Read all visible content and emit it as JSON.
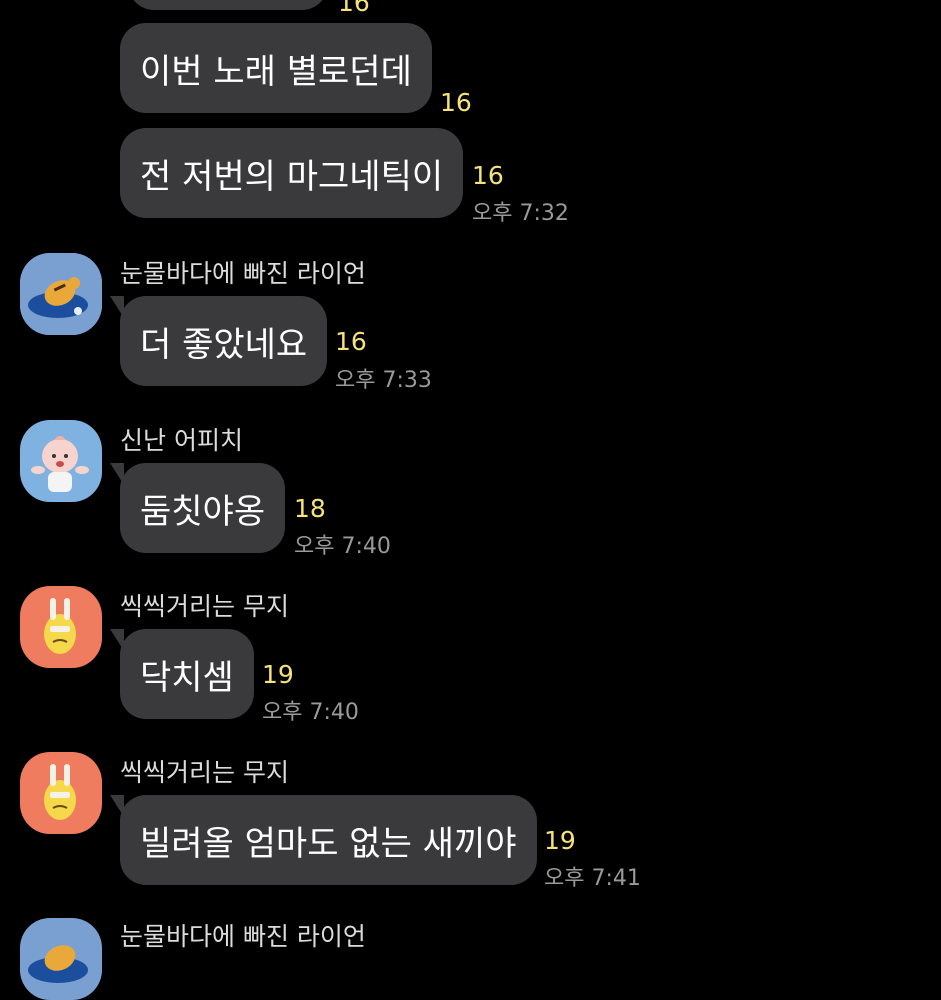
{
  "chat": {
    "colors": {
      "background": "#000000",
      "bubble": "#3a3a3c",
      "unread": "#f5e27a",
      "time": "#9a9a9a"
    },
    "messages": [
      {
        "text": "",
        "unread": "16"
      },
      {
        "text": "이번 노래 별로던데",
        "unread": "16"
      },
      {
        "text": "전 저번의 마그네틱이",
        "unread": "16",
        "time": "오후 7:32"
      },
      {
        "sender": "눈물바다에 빠진 라이언",
        "avatar": "ryan-avatar",
        "text": "더 좋았네요",
        "unread": "16",
        "time": "오후 7:33"
      },
      {
        "sender": "신난 어피치",
        "avatar": "apeach-avatar",
        "text": "둠칫야옹",
        "unread": "18",
        "time": "오후 7:40"
      },
      {
        "sender": "씩씩거리는 무지",
        "avatar": "muzi-avatar",
        "text": "닥치셈",
        "unread": "19",
        "time": "오후 7:40"
      },
      {
        "sender": "씩씩거리는 무지",
        "avatar": "muzi-avatar",
        "text": "빌려올 엄마도 없는 새끼야",
        "unread": "19",
        "time": "오후 7:41"
      },
      {
        "sender": "눈물바다에 빠진 라이언",
        "avatar": "ryan-avatar"
      }
    ]
  }
}
